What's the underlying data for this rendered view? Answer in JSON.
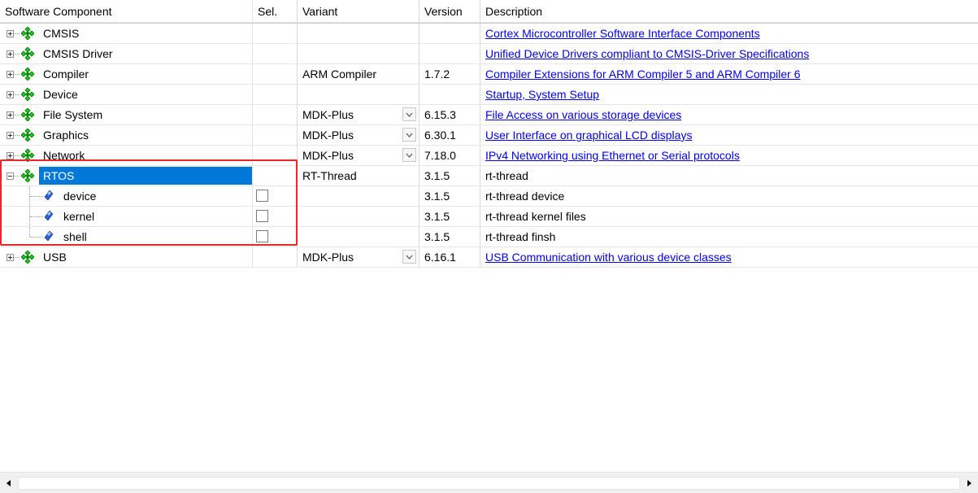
{
  "columns": {
    "component": "Software Component",
    "sel": "Sel.",
    "variant": "Variant",
    "version": "Version",
    "description": "Description"
  },
  "rows": [
    {
      "name": "CMSIS",
      "variant": "",
      "version": "",
      "description": "Cortex Microcontroller Software Interface Components",
      "link": true,
      "dropdown": false
    },
    {
      "name": "CMSIS Driver",
      "variant": "",
      "version": "",
      "description": "Unified Device Drivers compliant to CMSIS-Driver Specifications",
      "link": true,
      "dropdown": false
    },
    {
      "name": "Compiler",
      "variant": "ARM Compiler",
      "version": "1.7.2",
      "description": "Compiler Extensions for ARM Compiler 5 and ARM Compiler 6",
      "link": true,
      "dropdown": false
    },
    {
      "name": "Device",
      "variant": "",
      "version": "",
      "description": "Startup, System Setup",
      "link": true,
      "dropdown": false
    },
    {
      "name": "File System",
      "variant": "MDK-Plus",
      "version": "6.15.3",
      "description": "File Access on various storage devices",
      "link": true,
      "dropdown": true
    },
    {
      "name": "Graphics",
      "variant": "MDK-Plus",
      "version": "6.30.1",
      "description": "User Interface on graphical LCD displays",
      "link": true,
      "dropdown": true
    },
    {
      "name": "Network",
      "variant": "MDK-Plus",
      "version": "7.18.0",
      "description": "IPv4 Networking using Ethernet or Serial protocols",
      "link": true,
      "dropdown": true
    },
    {
      "name": "RTOS",
      "variant": "RT-Thread",
      "version": "3.1.5",
      "description": "rt-thread",
      "link": false,
      "dropdown": false,
      "selected": true,
      "expanded": true
    },
    {
      "name": "device",
      "variant": "",
      "version": "3.1.5",
      "description": "rt-thread device",
      "link": false,
      "child": true,
      "checkbox": true
    },
    {
      "name": "kernel",
      "variant": "",
      "version": "3.1.5",
      "description": "rt-thread kernel files",
      "link": false,
      "child": true,
      "checkbox": true
    },
    {
      "name": "shell",
      "variant": "",
      "version": "3.1.5",
      "description": "rt-thread finsh",
      "link": false,
      "child": true,
      "checkbox": true,
      "last_child": true
    },
    {
      "name": "USB",
      "variant": "MDK-Plus",
      "version": "6.16.1",
      "description": "USB Communication with various device classes",
      "link": true,
      "dropdown": true
    }
  ],
  "colors": {
    "selection": "#0078d7",
    "highlight_border": "#e8262b",
    "link": "#0000ee",
    "icon_green": "#20c420"
  }
}
